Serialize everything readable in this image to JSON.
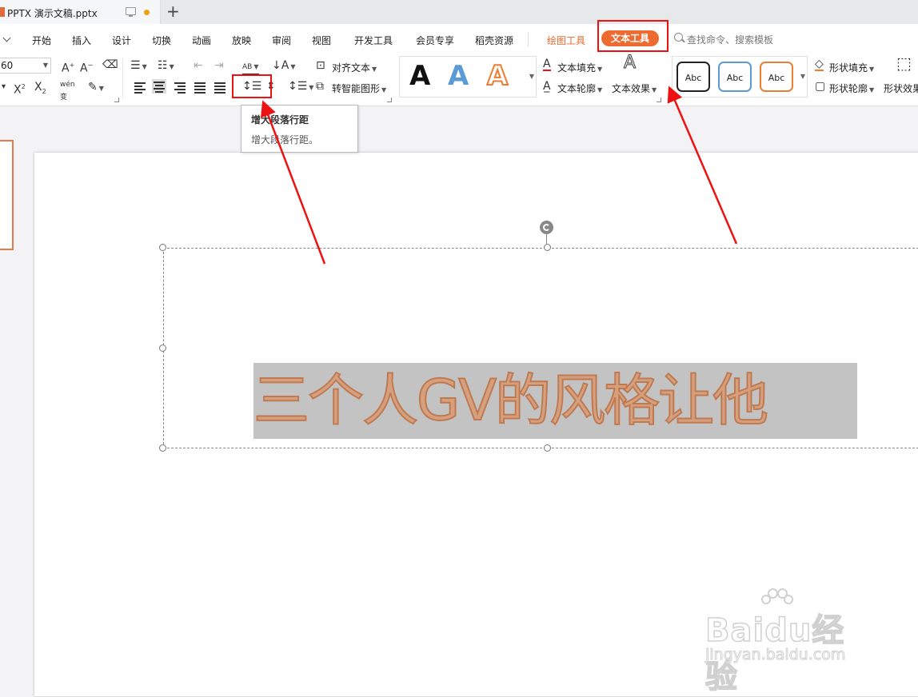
{
  "titlebar": {
    "doc_name": "PPTX 演示文稿.pptx",
    "new_tab": "+"
  },
  "menu": {
    "items": [
      "开始",
      "插入",
      "设计",
      "切换",
      "动画",
      "放映",
      "审阅",
      "视图",
      "开发工具",
      "会员专享",
      "稻壳资源"
    ],
    "drawing_tools": "绘图工具",
    "text_tools": "文本工具",
    "search_placeholder": "查找命令、搜索模板"
  },
  "ribbon": {
    "font_size": "60",
    "align_text": "对齐文本",
    "to_smart_art": "转智能图形",
    "text_fill": "文本填充",
    "text_outline": "文本轮廓",
    "text_effect": "文本效果",
    "shape_fill": "形状填充",
    "shape_outline": "形状轮廓",
    "shape_effect": "形状效果",
    "ab_label": "AB",
    "wen_label": "wén",
    "wen_char": "变",
    "art_letter": "A",
    "abc": "Abc"
  },
  "tooltip": {
    "title": "增大段落行距",
    "desc": "增大段落行距。"
  },
  "slide": {
    "title_text": "三个人GV的风格让他"
  },
  "watermark": {
    "brand": "Baidu经验",
    "url": "jingyan.baidu.com"
  },
  "colors": {
    "accent": "#ed6a30",
    "highlight": "#e11111"
  }
}
